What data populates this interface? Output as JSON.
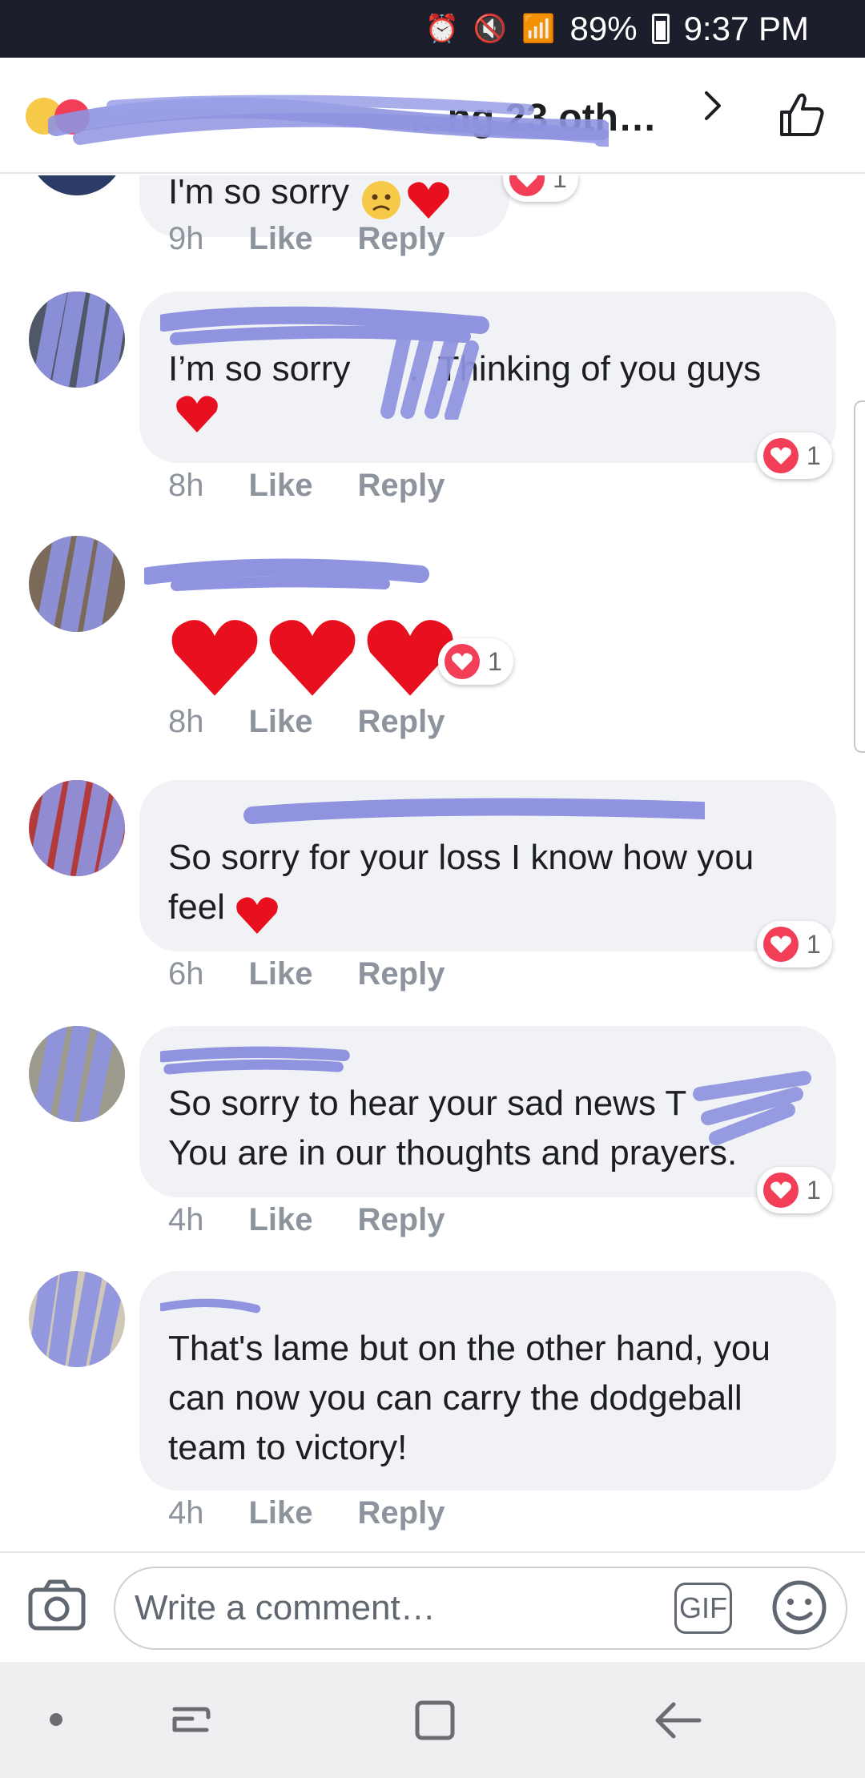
{
  "status_bar": {
    "battery": "89%",
    "time": "9:37 PM"
  },
  "header": {
    "title": "…ng 23 oth…"
  },
  "comments": [
    {
      "text": "I'm so sorry",
      "time": "9h",
      "like_label": "Like",
      "reply_label": "Reply",
      "reaction_count": "1"
    },
    {
      "text": "I’m so sorry      .  Thinking of you guys",
      "time": "8h",
      "like_label": "Like",
      "reply_label": "Reply",
      "reaction_count": "1"
    },
    {
      "text": "",
      "time": "8h",
      "like_label": "Like",
      "reply_label": "Reply",
      "reaction_count": "1"
    },
    {
      "text": "So sorry for your loss I know how you feel",
      "time": "6h",
      "like_label": "Like",
      "reply_label": "Reply",
      "reaction_count": "1"
    },
    {
      "text": "So sorry to hear your sad news T\nYou are in our thoughts and prayers.",
      "time": "4h",
      "like_label": "Like",
      "reply_label": "Reply",
      "reaction_count": "1"
    },
    {
      "text": "That's lame but on the other hand, you can now you can carry the dodgeball team to victory!",
      "time": "4h",
      "like_label": "Like",
      "reply_label": "Reply"
    }
  ],
  "composer": {
    "placeholder": "Write a comment…",
    "gif_label": "GIF"
  },
  "colors": {
    "accent_heart": "#f33e58",
    "bubble": "#f0f2f5",
    "redaction": "#8f93e0"
  }
}
